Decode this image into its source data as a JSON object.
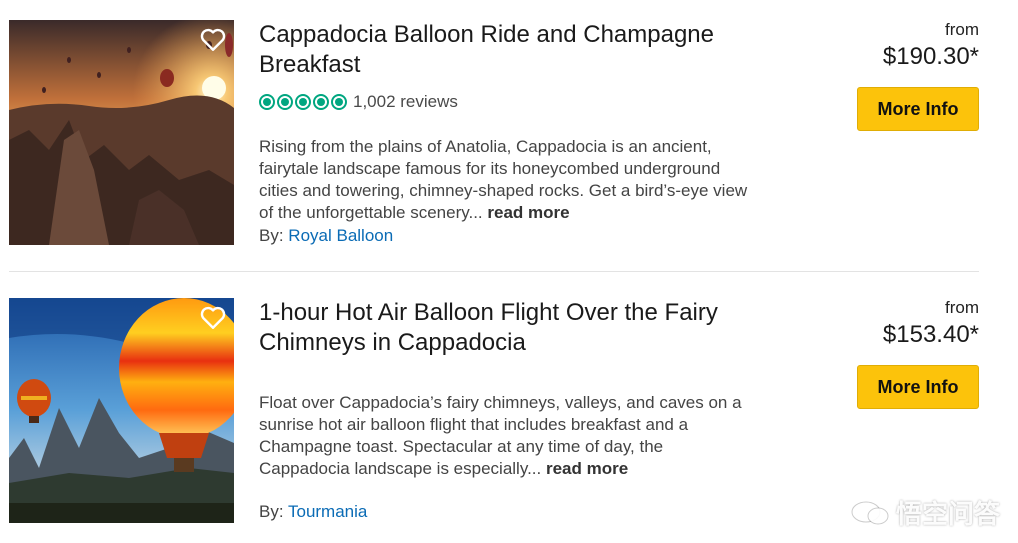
{
  "listings": [
    {
      "title": "Cappadocia Balloon Ride and Champagne Breakfast",
      "rating_bubbles": 5,
      "reviews": "1,002 reviews",
      "description": "Rising from the plains of Anatolia, Cappadocia is an ancient, fairytale landscape famous for its honeycombed underground cities and towering, chimney-shaped rocks. Get a bird’s-eye view of the unforgettable scenery...",
      "read_more": "read more",
      "by_label": "By:",
      "operator": "Royal Balloon",
      "from_label": "from",
      "price": "$190.30*",
      "button_label": "More Info"
    },
    {
      "title": "1-hour Hot Air Balloon Flight Over the Fairy Chimneys in Cappadocia",
      "description": "Float over Cappadocia’s fairy chimneys, valleys, and caves on a sunrise hot air balloon flight that includes breakfast and a Champagne toast. Spectacular at any time of day, the Cappadocia landscape is especially...",
      "read_more": "read more",
      "by_label": "By:",
      "operator": "Tourmania",
      "from_label": "from",
      "price": "$153.40*",
      "button_label": "More Info"
    }
  ],
  "watermark": {
    "text": "悟空问答"
  },
  "colors": {
    "button": "#fcc30b",
    "rating": "#00a680",
    "link": "#0a6bb5"
  }
}
